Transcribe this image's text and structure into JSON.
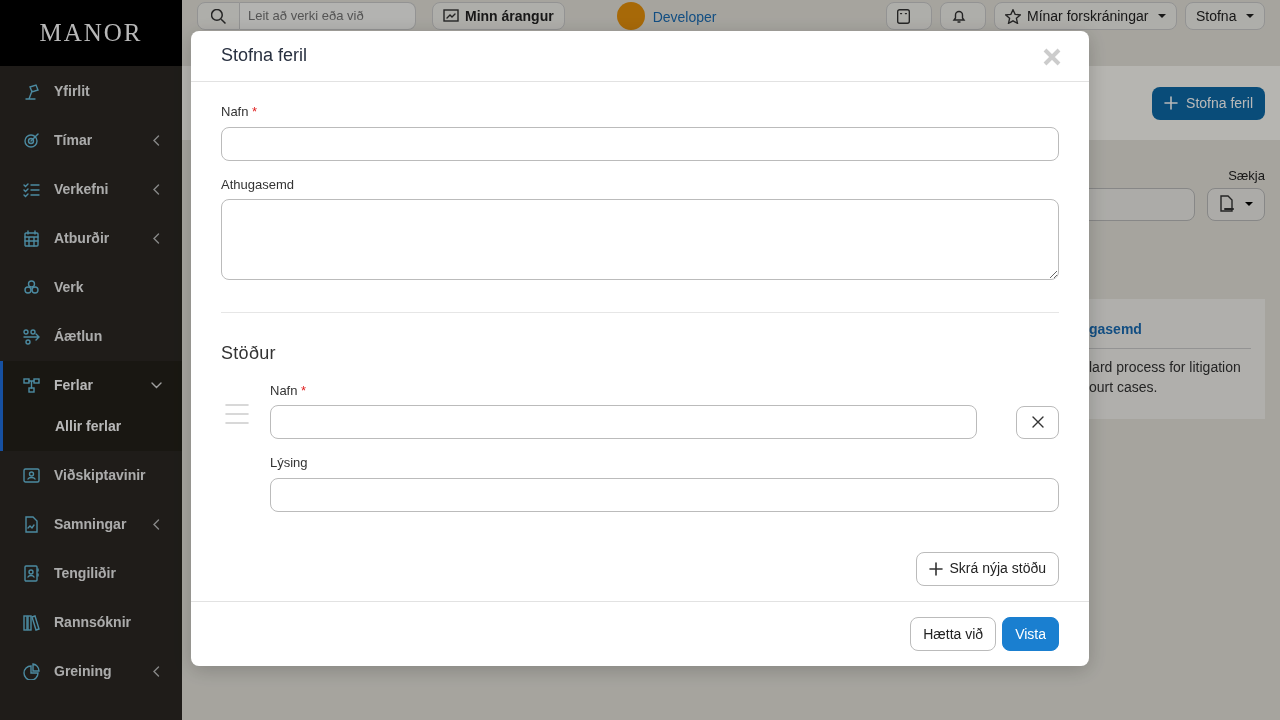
{
  "sidebar": {
    "logo": "MANOR",
    "items": [
      {
        "label": "Yfirlit",
        "kind": "link",
        "selected": false
      },
      {
        "label": "Tímar",
        "kind": "group",
        "expanded": false,
        "selected": false
      },
      {
        "label": "Verkefni",
        "kind": "group",
        "expanded": false,
        "selected": false
      },
      {
        "label": "Atburðir",
        "kind": "group",
        "expanded": false,
        "selected": false
      },
      {
        "label": "Verk",
        "kind": "link",
        "selected": false
      },
      {
        "label": "Áætlun",
        "kind": "link",
        "selected": false
      },
      {
        "label": "Ferlar",
        "kind": "group",
        "expanded": true,
        "selected": true,
        "children": [
          {
            "label": "Allir ferlar",
            "selected": true
          }
        ]
      },
      {
        "label": "Viðskiptavinir",
        "kind": "link",
        "selected": false
      },
      {
        "label": "Samningar",
        "kind": "group",
        "expanded": false,
        "selected": false
      },
      {
        "label": "Tengiliðir",
        "kind": "link",
        "selected": false
      },
      {
        "label": "Rannsóknir",
        "kind": "link",
        "selected": false
      },
      {
        "label": "Greining",
        "kind": "group",
        "expanded": false,
        "selected": false
      }
    ]
  },
  "topbar": {
    "search": {
      "placeholder": "Leit að verki eða við"
    },
    "results_button": "Minn árangur",
    "user": "Developer",
    "dropdowns": [
      "Mínar forskráningar",
      "Stofna"
    ]
  },
  "page": {
    "create_button": "Stofna feril",
    "export_label": "Sækja",
    "card": {
      "column_header": "gasemd",
      "text_lines": [
        "lard process for litigation",
        "ourt cases."
      ]
    }
  },
  "modal": {
    "title": "Stofna feril",
    "fields": [
      {
        "label": "Nafn",
        "required_mark": "*",
        "kind": "input"
      },
      {
        "label": "Athugasemd",
        "kind": "textarea"
      }
    ],
    "section_title": "Stöður",
    "statuses": [
      {
        "fields": [
          {
            "label": "Nafn",
            "required_mark": "*"
          },
          {
            "label": "Lýsing"
          }
        ]
      }
    ],
    "add_button": "Skrá nýja stöðu",
    "footer_buttons": [
      {
        "label": "Hætta við",
        "kind": "secondary"
      },
      {
        "label": "Vista",
        "kind": "primary"
      }
    ]
  }
}
